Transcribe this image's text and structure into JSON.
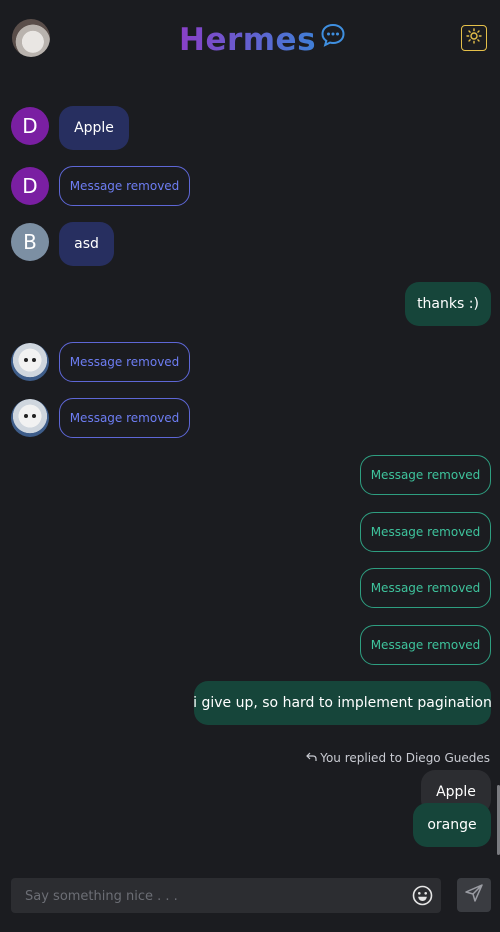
{
  "header": {
    "brand": "Hermes",
    "icons": {
      "chat": "chat-bubble-icon",
      "theme": "sun-icon"
    },
    "colors": {
      "brand_start": "#8a3fc7",
      "brand_end": "#3f7fd6",
      "theme_border": "#e5c04a"
    }
  },
  "messages": {
    "m1": {
      "avatar": "D",
      "text": "Apple"
    },
    "m2": {
      "avatar": "D",
      "text": "Message removed"
    },
    "m3": {
      "avatar": "B",
      "text": "asd"
    },
    "m4": {
      "text": "thanks :)"
    },
    "m5": {
      "text": "Message removed"
    },
    "m6": {
      "text": "Message removed"
    },
    "m7": {
      "text": "Message removed"
    },
    "m8": {
      "text": "Message removed"
    },
    "m9": {
      "text": "Message removed"
    },
    "m10": {
      "text": "Message removed"
    },
    "m11": {
      "text": "i give up, so hard to implement pagination"
    },
    "reply_label": "You replied to Diego Guedes",
    "reply_quote": "Apple",
    "m12": {
      "text": "orange"
    }
  },
  "composer": {
    "placeholder": "Say something nice . . .",
    "value": "",
    "emoji_icon": "smiley-icon",
    "send_icon": "send-icon"
  },
  "colors": {
    "background": "#1b1c20",
    "incoming_bubble": "#272f60",
    "outgoing_bubble": "#16453a",
    "removed_incoming": "#6d7df2",
    "removed_outgoing": "#3ec39c",
    "avatar_d": "#7a1fa2",
    "avatar_b": "#7c8fa3"
  }
}
